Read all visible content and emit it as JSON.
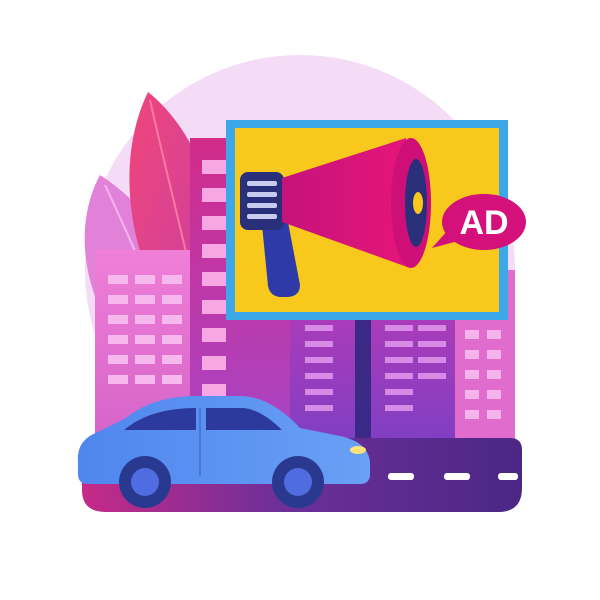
{
  "illustration": {
    "billboard": {
      "speech_bubble_text": "AD"
    },
    "colors": {
      "background_circle": "#f3d8f6",
      "leaf_dark": "#e2456f",
      "leaf_light": "#e283d8",
      "building_magenta": "#c83fb6",
      "building_violet": "#8a43c8",
      "building_pink": "#e067c9",
      "window": "#f6b7ec",
      "billboard_frame": "#3da8e8",
      "billboard_panel": "#f9cc1a",
      "megaphone": "#d4107a",
      "megaphone_handle": "#2e3aa8",
      "megaphone_grip": "#2a2f7a",
      "speech_bubble": "#d4107a",
      "road": "#5a2a8c",
      "road_edge": "#d21d77",
      "road_marking": "#ffffff",
      "car_body": "#5b8ff0",
      "car_window": "#2c3a9e",
      "car_wheel": "#2a3990"
    },
    "icons": [
      "megaphone-icon",
      "speech-bubble-icon",
      "car-icon",
      "leaf-icon"
    ]
  }
}
